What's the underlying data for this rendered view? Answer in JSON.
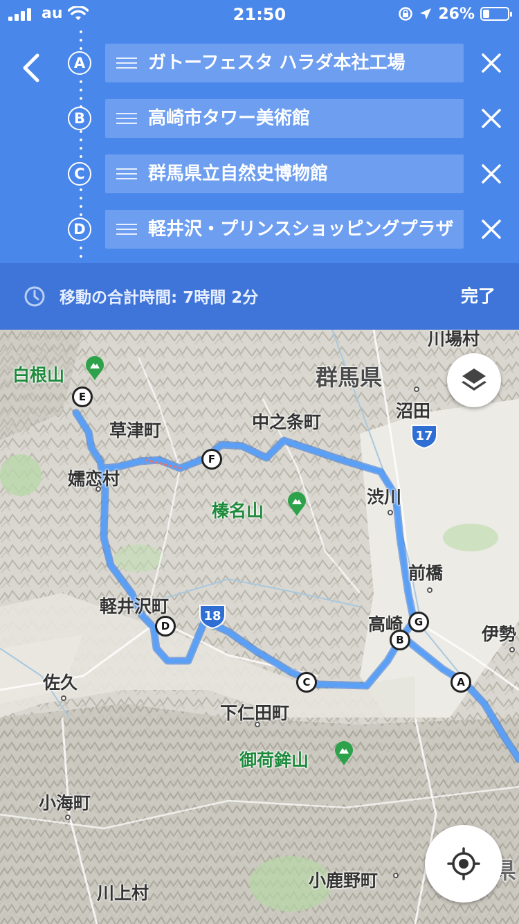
{
  "status_bar": {
    "carrier": "au",
    "time": "21:50",
    "battery_percent_text": "26%",
    "battery_level": 0.26
  },
  "waypoints": [
    {
      "letter": "A",
      "name": "ガトーフェスタ ハラダ本社工場"
    },
    {
      "letter": "B",
      "name": "高崎市タワー美術館"
    },
    {
      "letter": "C",
      "name": "群馬県立自然史博物館"
    },
    {
      "letter": "D",
      "name": "軽井沢・プリンスショッピングプラザ"
    }
  ],
  "summary": {
    "total_time": "移動の合計時間: 7時間 2分",
    "done_label": "完了"
  },
  "map": {
    "labels": {
      "kawaba": "川場村",
      "shiraneyama": "白根山",
      "gunma": "群馬県",
      "numata": "沼田",
      "kusatsu": "草津町",
      "nakanojo": "中之条町",
      "tsumagoi": "嬬恋村",
      "shibukawa": "渋川",
      "harunasan": "榛名山",
      "maebashi": "前橋",
      "karuizawa": "軽井沢町",
      "takasaki": "高崎",
      "isesaki": "伊勢",
      "saku": "佐久",
      "shimonita": "下仁田町",
      "mikabosan": "御荷鉾山",
      "koumi": "小海町",
      "kanna": "小鹿野町",
      "kawakami": "川上村",
      "saitama_partial": "埼玉県"
    },
    "route_markers": [
      "A",
      "B",
      "C",
      "D",
      "E",
      "F",
      "G"
    ],
    "highway_shields": [
      "17",
      "18"
    ],
    "route_color": "#4a8ff0"
  },
  "icons": {
    "back": "chevron-left-icon",
    "remove": "close-icon",
    "drag": "drag-handle-icon",
    "clock": "clock-icon",
    "layers": "layers-icon",
    "locate": "my-location-icon",
    "peak": "mountain-peak-icon"
  }
}
